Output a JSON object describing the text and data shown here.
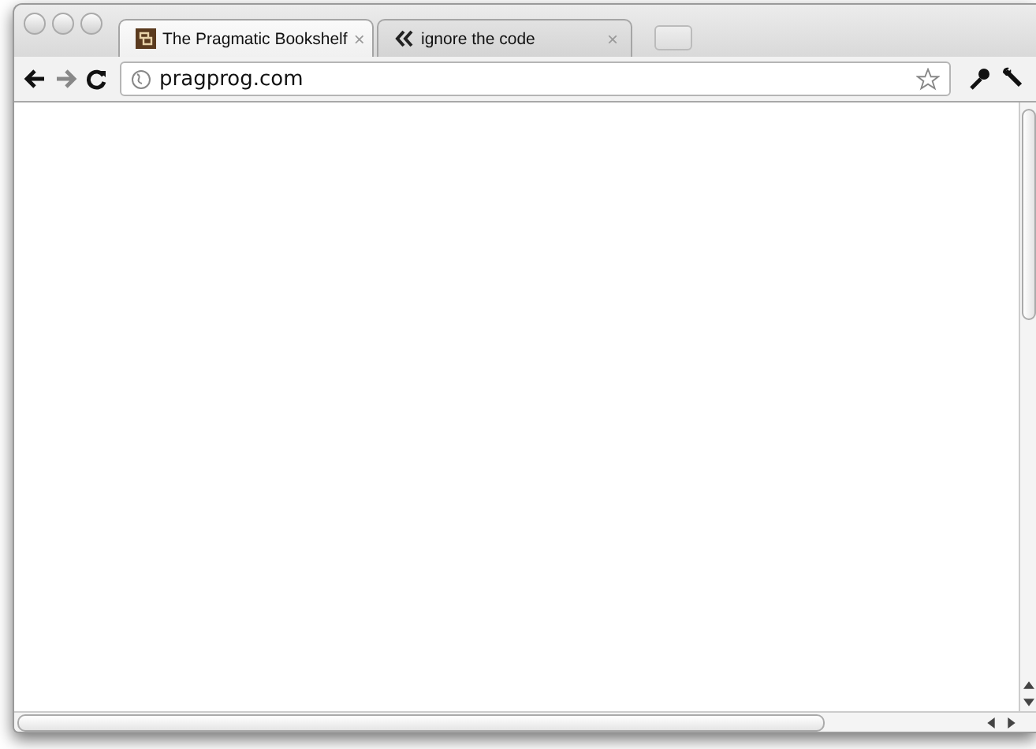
{
  "tabs": [
    {
      "title": "The Pragmatic Bookshelf",
      "kind": "bookshelf",
      "selected": true
    },
    {
      "title": "ignore the code",
      "kind": "chevrons",
      "selected": false
    }
  ],
  "address": {
    "url": "pragprog.com"
  },
  "close_glyph": "×"
}
